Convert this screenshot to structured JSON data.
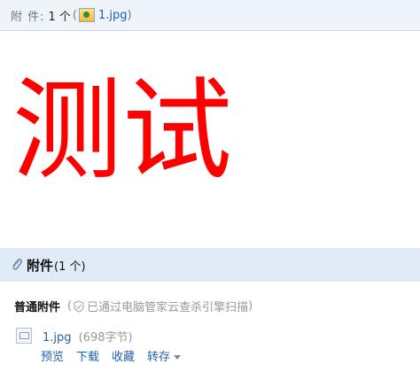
{
  "header": {
    "label": "附  件:",
    "count": "1 个",
    "paren_open": "(",
    "file_name": "1.jpg",
    "paren_close": ")"
  },
  "body": {
    "big_text": "测试"
  },
  "attachments": {
    "title": "附件",
    "count": "(1 个)",
    "normal_label": "普通附件",
    "scan_status": "已通过电脑管家云查杀引擎扫描",
    "scan_open": "(",
    "scan_close": ")",
    "file": {
      "name": "1.jpg",
      "size": "(698字节)"
    },
    "actions": {
      "preview": "预览",
      "download": "下载",
      "favorite": "收藏",
      "transfer": "转存"
    }
  },
  "colors": {
    "accent_text": "#ff0000",
    "link": "#1f5fb0",
    "attachment_bar": "#e0ebf7"
  }
}
